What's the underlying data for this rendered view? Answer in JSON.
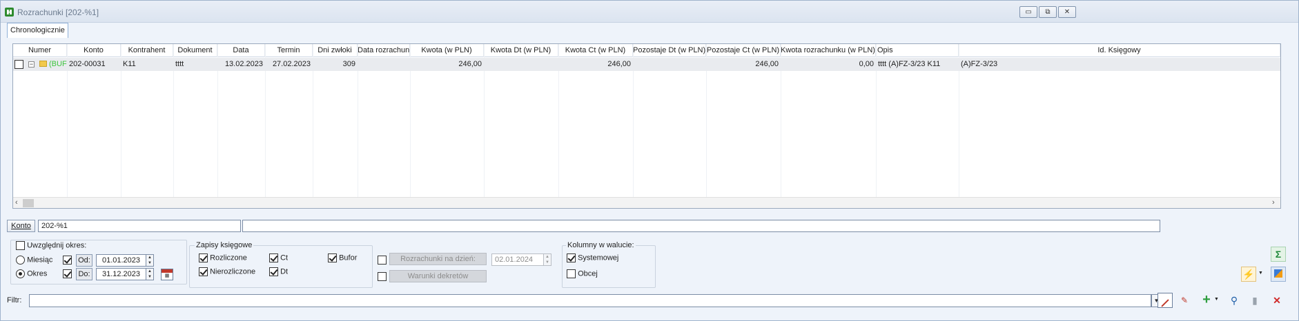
{
  "window": {
    "title": "Rozrachunki [202-%1]",
    "min_label": "▭",
    "restore_label": "⧉",
    "close_label": "✕"
  },
  "tabs": [
    {
      "label": "Chronologicznie"
    }
  ],
  "grid": {
    "headers": [
      "Numer",
      "Konto",
      "Kontrahent",
      "Dokument",
      "Data",
      "Termin",
      "Dni zwłoki",
      "Data rozrachunku",
      "Kwota (w PLN)",
      "Kwota Dt (w PLN)",
      "Kwota Ct (w PLN)",
      "Pozostaje Dt (w PLN)",
      "Pozostaje Ct (w PLN)",
      "Kwota rozrachunku (w PLN)",
      "Opis",
      "Id. Księgowy"
    ],
    "rows": [
      {
        "numer": "(BUFO",
        "konto": "202-00031",
        "kontrahent": "K11",
        "dokument": "tttt",
        "data": "13.02.2023",
        "termin": "27.02.2023",
        "dni_zwloki": "309",
        "data_rozrachunku": "",
        "kwota": "246,00",
        "kwota_dt": "",
        "kwota_ct": "246,00",
        "pozostaje_dt": "",
        "pozostaje_ct": "246,00",
        "kwota_rozrachunku": "0,00",
        "opis": "tttt (A)FZ-3/23 K11",
        "id_ksiegowy": "(A)FZ-3/23"
      }
    ]
  },
  "konto": {
    "button_label": "Konto",
    "value": "202-%1",
    "description": ""
  },
  "okres": {
    "uwzglednij_label": "Uwzględnij okres:",
    "miesiac_label": "Miesiąc",
    "okres_label": "Okres",
    "od_label": "Od:",
    "do_label": "Do:",
    "od_value": "01.01.2023",
    "do_value": "31.12.2023"
  },
  "zapisy": {
    "legend": "Zapisy księgowe",
    "rozliczone": "Rozliczone",
    "nierozliczone": "Nierozliczone",
    "ct": "Ct",
    "dt": "Dt",
    "bufor": "Bufor"
  },
  "rozrachunki": {
    "na_dzien_label": "Rozrachunki na dzień:",
    "na_dzien_value": "02.01.2024",
    "warunki_label": "Warunki dekretów"
  },
  "waluta": {
    "legend": "Kolumny w walucie:",
    "systemowej": "Systemowej",
    "obcej": "Obcej"
  },
  "filter": {
    "label": "Filtr:",
    "value": ""
  },
  "icons": {
    "sigma": "Σ",
    "lightning": "⚡",
    "plus": "+",
    "search": "🔍",
    "trash": "🗑",
    "close": "✕"
  }
}
